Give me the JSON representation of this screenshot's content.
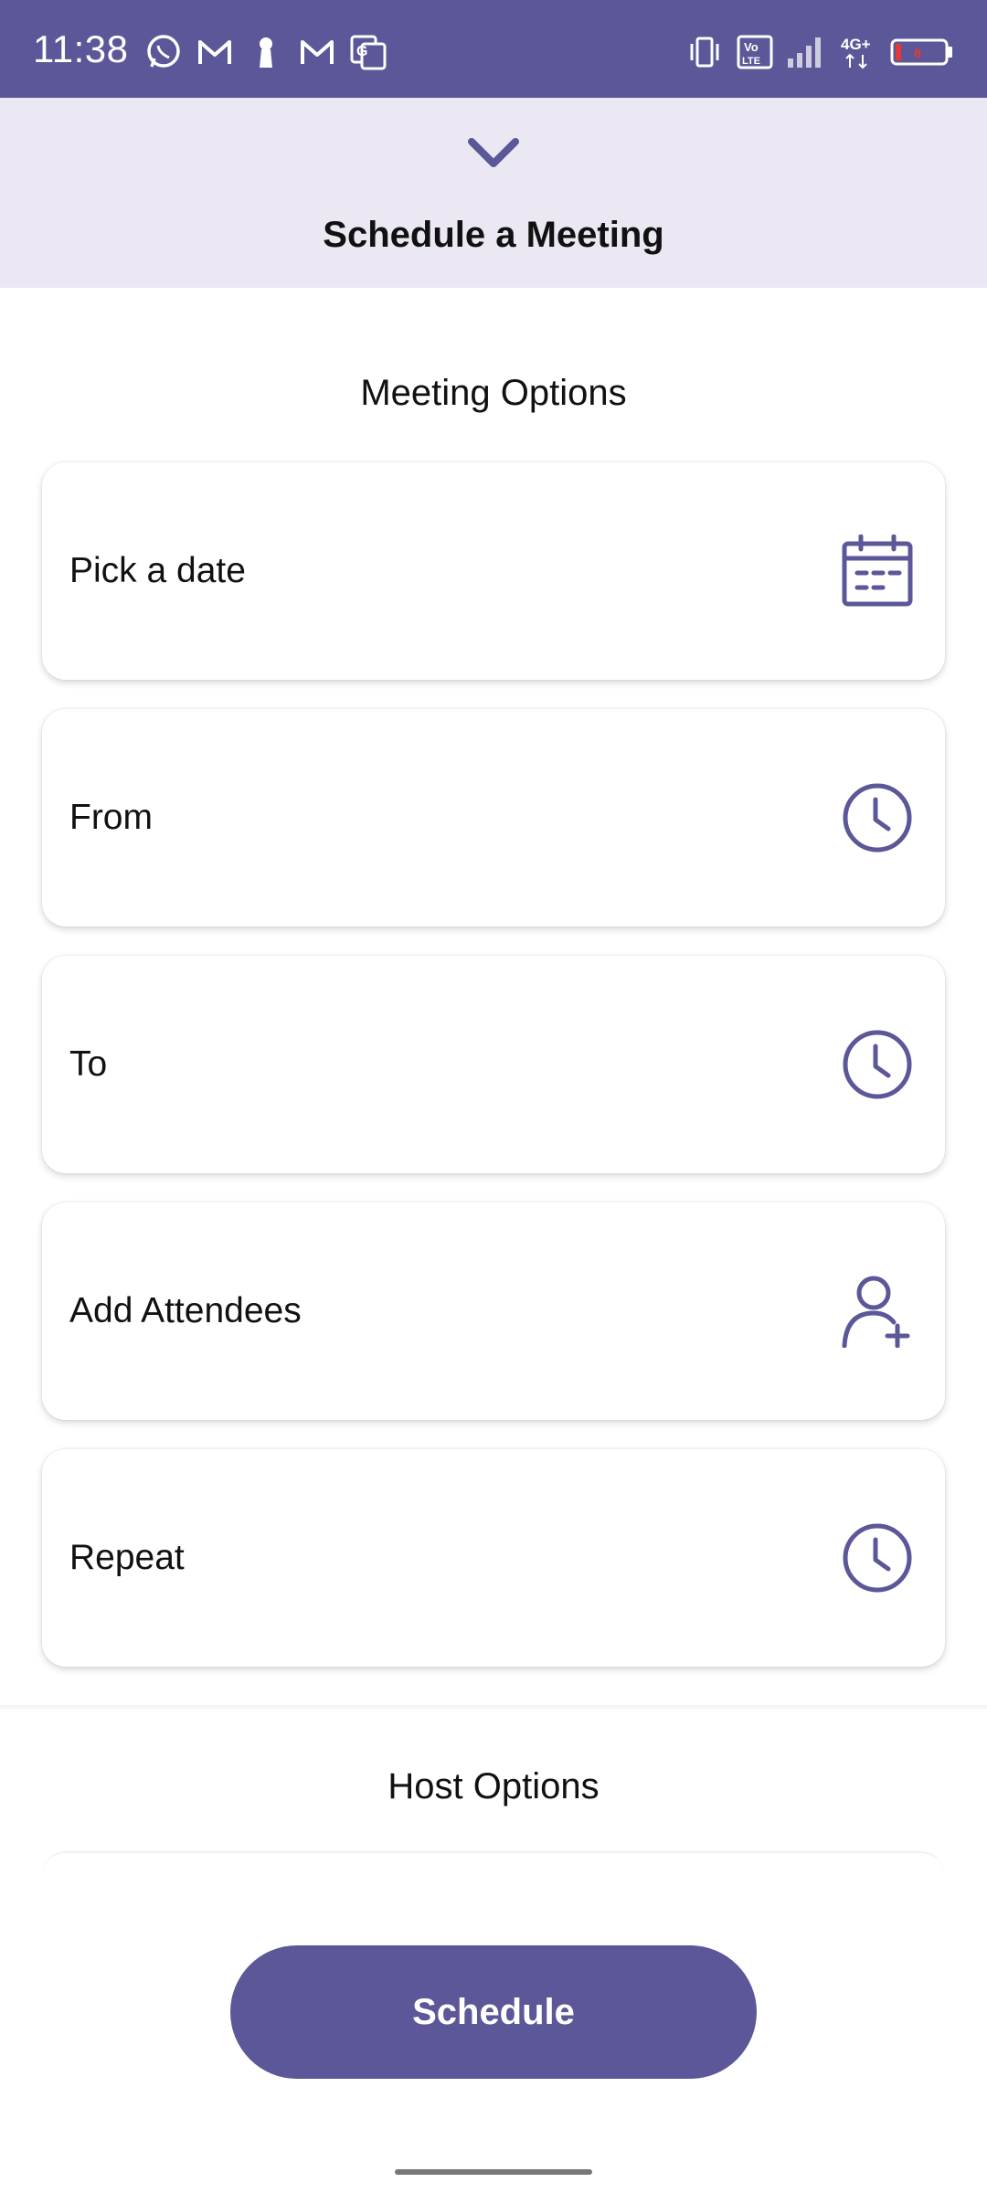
{
  "status_bar": {
    "time": "11:38",
    "left_icons": [
      "whatsapp-icon",
      "gmail-icon",
      "keyhole-icon",
      "gmail-icon",
      "translate-icon"
    ],
    "right_icons": [
      "vibrate-icon",
      "volte-icon",
      "signal-icon",
      "network-4g-icon",
      "battery-icon"
    ],
    "network_label": "4G+",
    "volte_label": "Vo LTE",
    "battery_level": "8",
    "background": "#5b5798"
  },
  "sheet": {
    "title": "Schedule a Meeting",
    "collapse_icon": "chevron-down-icon",
    "header_background": "#ebe8f4"
  },
  "meeting_options": {
    "title": "Meeting Options",
    "items": [
      {
        "label": "Pick a date",
        "icon": "calendar-icon"
      },
      {
        "label": "From",
        "icon": "clock-icon"
      },
      {
        "label": "To",
        "icon": "clock-icon"
      },
      {
        "label": "Add Attendees",
        "icon": "add-person-icon"
      },
      {
        "label": "Repeat",
        "icon": "clock-icon"
      }
    ]
  },
  "host_options": {
    "title": "Host Options"
  },
  "actions": {
    "schedule_label": "Schedule"
  },
  "colors": {
    "accent": "#5b5798",
    "icon": "#5b5798",
    "card_background": "#ffffff"
  }
}
